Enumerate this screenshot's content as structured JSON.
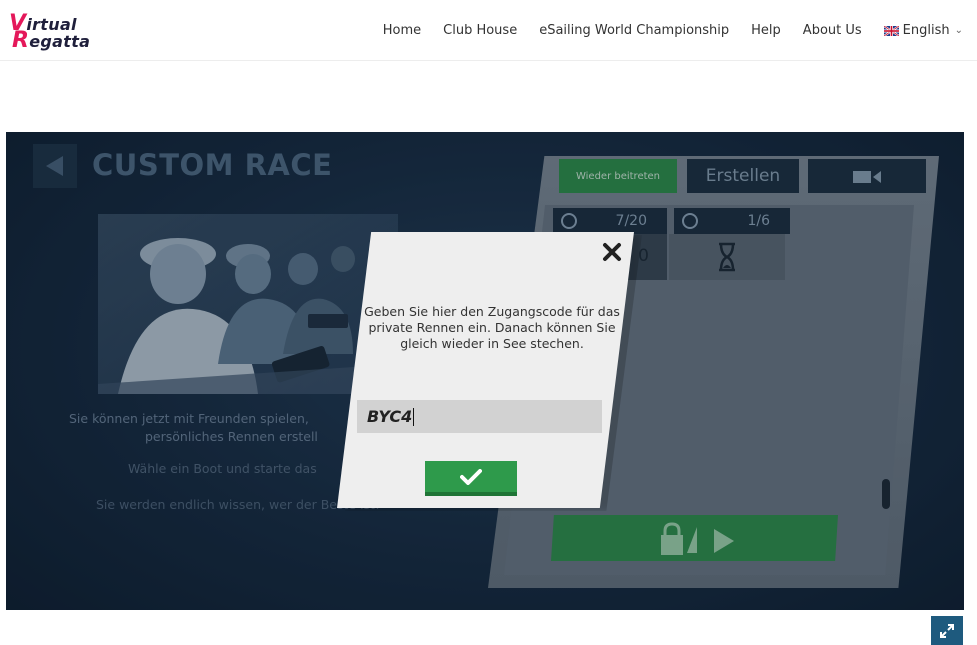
{
  "logo": {
    "line1_cap": "V",
    "line1_rest": "irtual",
    "line2_cap": "R",
    "line2_rest": "egatta"
  },
  "nav": {
    "items": [
      "Home",
      "Club House",
      "eSailing World Championship",
      "Help",
      "About Us"
    ],
    "language": "English",
    "language_icon": "uk-flag-icon"
  },
  "game": {
    "title": "CUSTOM RACE",
    "promo": [
      "Sie können jetzt mit Freunden spielen,",
      "persönliches Rennen erstell",
      "Wähle ein Boot und starte das",
      "Sie werden endlich wissen, wer der Beste ist!"
    ],
    "tabs": {
      "rejoin": "Wieder beitreten",
      "create": "Erstellen",
      "video_icon": "video-camera-icon"
    },
    "stats": {
      "boats": "7/20",
      "races": "1/6"
    },
    "tile_partial": "0"
  },
  "modal": {
    "message": "Geben Sie hier den Zugangscode für das private Rennen ein. Danach können Sie gleich wieder in See stechen.",
    "code_value": "BYC4"
  },
  "colors": {
    "accent_green": "#2e9a4b",
    "brand_pink": "#e4185a",
    "dark_navy": "#172c42"
  }
}
